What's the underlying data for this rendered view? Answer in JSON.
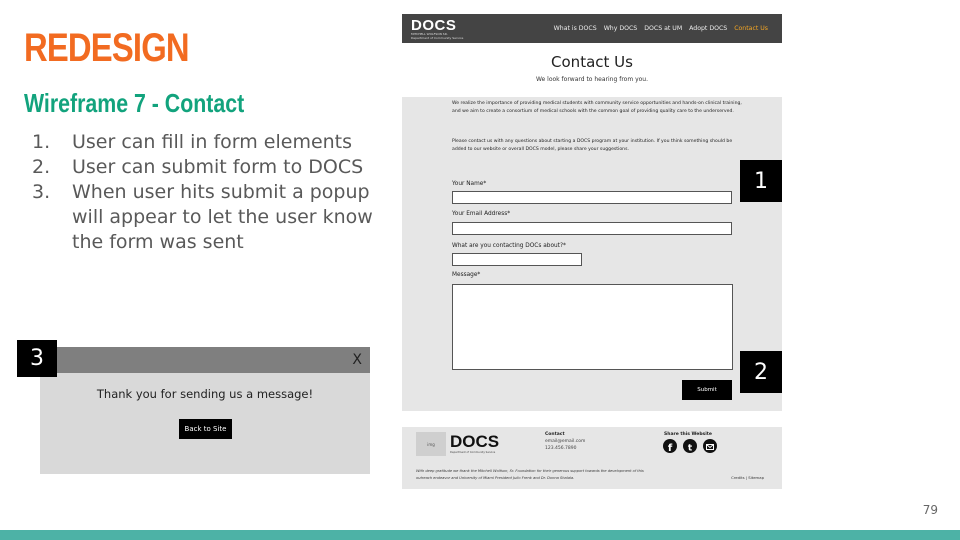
{
  "slide": {
    "title": "REDESIGN",
    "subtitle": "Wireframe 7 - Contact",
    "requirements": [
      {
        "num": "1.",
        "text": "User can fill in form elements"
      },
      {
        "num": "2.",
        "text": "User can submit form to DOCS"
      },
      {
        "num": "3.",
        "text": "When user hits submit a popup will appear to let the user know the form was sent"
      }
    ],
    "page_number": "79",
    "colors": {
      "title": "#f26b21",
      "subtitle": "#12a37d",
      "bottom_bar": "#4db2a6"
    }
  },
  "badges": {
    "one": "1",
    "two": "2",
    "three": "3"
  },
  "popup": {
    "close": "X",
    "message": "Thank you for sending us a message!",
    "button": "Back to Site"
  },
  "wireframe": {
    "nav": {
      "logo": "DOCS",
      "logo_sub_1": "MITCHELL WOLFSON SR.",
      "logo_sub_2": "Department of Community Service",
      "links": [
        "What is DOCS",
        "Why DOCS",
        "DOCS at UM",
        "Adopt DOCS",
        "Contact Us"
      ],
      "active_color": "#f5a623"
    },
    "heading": "Contact Us",
    "tagline": "We look forward to hearing from you.",
    "intro_1": "We realize the importance of providing medical students with community service opportunities and hands-on clinical training, and we aim to create a consortium of medical schools with the common goal of providing quality care to the underserved.",
    "intro_2": "Please contact us with any questions about starting a DOCS program at your institution. If you think something should be added to our website or overall DOCS model, please share your suggestions.",
    "form": {
      "name_label": "Your Name*",
      "email_label": "Your Email Address*",
      "about_label": "What are you contacting DOCs about?*",
      "message_label": "Message*",
      "submit": "Submit"
    },
    "footer": {
      "image_label": "img",
      "logo": "DOCS",
      "logo_sub": "Department of Community Service",
      "contact_head": "Contact",
      "contact_email": "email@email.com",
      "contact_phone": "123.456.7890",
      "share_head": "Share this Website",
      "social_icons": [
        "facebook-icon",
        "twitter-icon",
        "email-icon"
      ],
      "note": "With deep gratitude we thank the Mitchell Wolfson, Sr. Foundation for their generous support towards the development of this outreach endeavor and University of Miami President Julio Frenk and Dr. Donna Shalala.",
      "links": "Credits | Sitemap"
    }
  }
}
